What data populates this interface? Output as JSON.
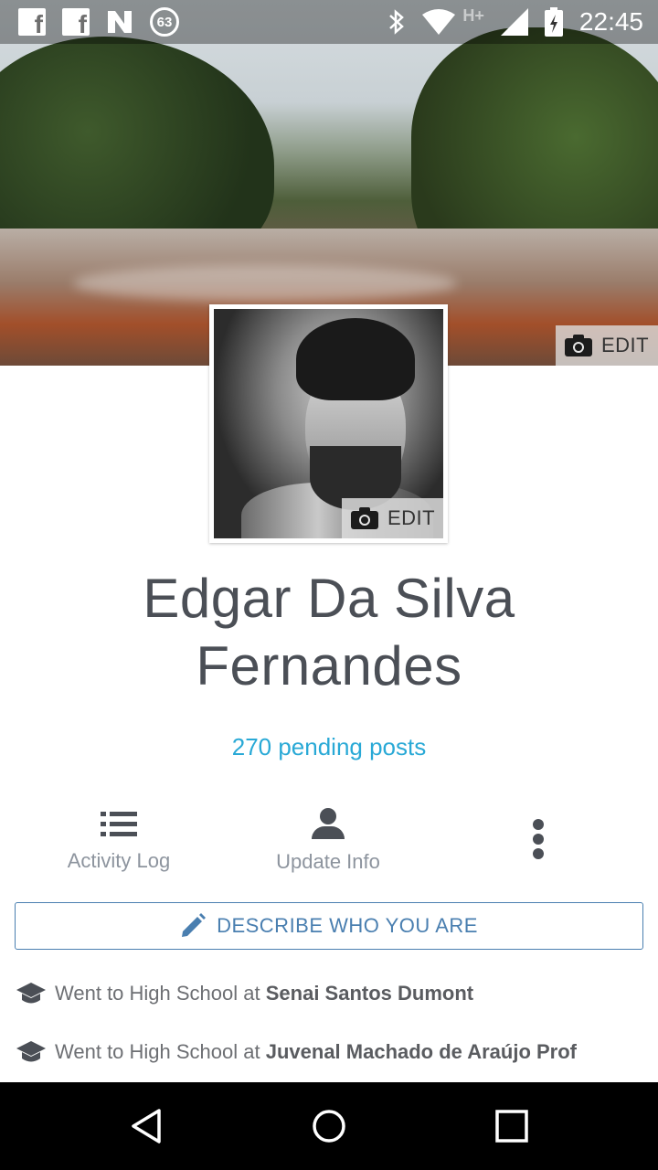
{
  "status_bar": {
    "time": "22:45",
    "notification_count": "63",
    "network_label": "H+",
    "icons": [
      "facebook-icon",
      "facebook-icon",
      "n-app-icon",
      "badge-icon",
      "bluetooth-icon",
      "wifi-icon",
      "signal-icon",
      "battery-icon"
    ]
  },
  "cover": {
    "edit_label": "EDIT",
    "edit_icon": "camera-icon"
  },
  "profile": {
    "edit_label": "EDIT",
    "edit_icon": "camera-icon",
    "name_line1": "Edgar Da Silva",
    "name_line2": "Fernandes",
    "pending_posts": "270 pending posts"
  },
  "actions": [
    {
      "label": "Activity Log",
      "icon": "list-icon"
    },
    {
      "label": "Update Info",
      "icon": "person-icon"
    },
    {
      "label": "",
      "icon": "more-vertical-icon"
    }
  ],
  "describe": {
    "label": "DESCRIBE WHO YOU ARE",
    "icon": "pencil-icon"
  },
  "education": [
    {
      "prefix": "Went to High School at ",
      "school": "Senai Santos Dumont",
      "icon": "graduation-cap-icon"
    },
    {
      "prefix": "Went to High School at ",
      "school": "Juvenal Machado de Araújo Prof",
      "icon": "graduation-cap-icon"
    }
  ],
  "colors": {
    "accent_blue": "#29a9d6",
    "button_blue": "#4a7fb0",
    "text_dark": "#4b4f56",
    "text_muted": "#8d949e"
  }
}
